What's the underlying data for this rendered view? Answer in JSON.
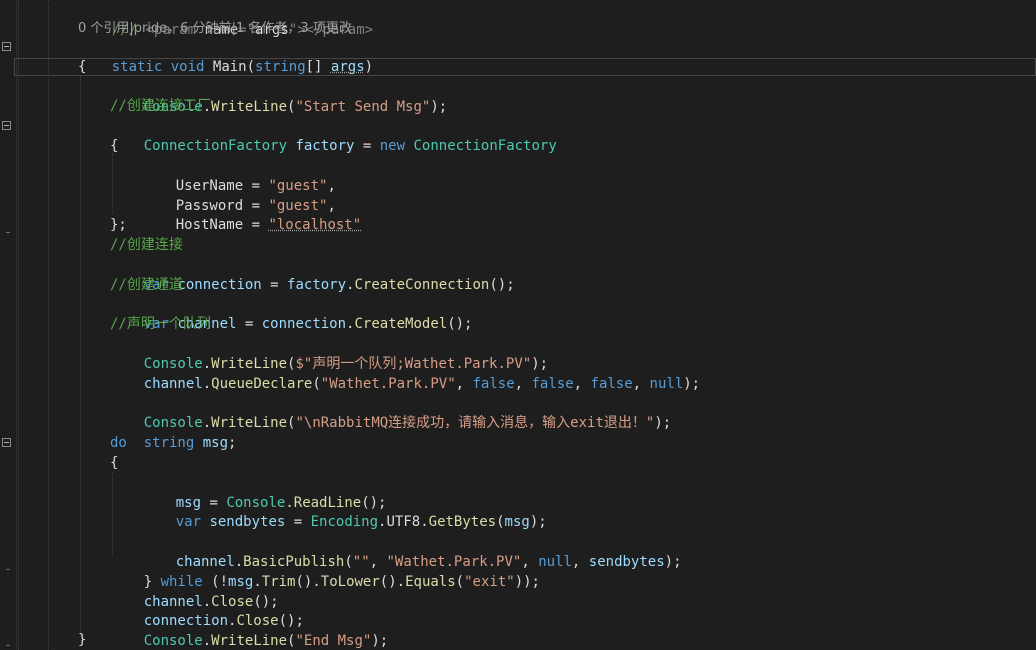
{
  "code": {
    "line1": {
      "doc": "/// ",
      "tag_open": "<param ",
      "attr": "name",
      "eq": "=\"",
      "value": "args",
      "quote": "\"",
      "tag_close": "></param>"
    },
    "codelens": "0 个引用|pride，6 分钟前|1 名作者，3 项更改",
    "line2": {
      "kw1": "static",
      "kw2": "void",
      "name": "Main",
      "paren": "(",
      "kw3": "string",
      "brackets": "[] ",
      "param": "args",
      "close": ")"
    },
    "line3": {
      "brace": "{"
    },
    "line4": {
      "cls": "Console",
      "dot": ".",
      "fn": "WriteLine",
      "open": "(",
      "str": "\"Start Send Msg\"",
      "close": ");"
    },
    "line5": {
      "comment": "//创建连接工厂"
    },
    "line6": {
      "type": "ConnectionFactory",
      "var": " factory",
      "eq": " = ",
      "kw": "new",
      "type2": " ConnectionFactory"
    },
    "line7": {
      "brace": "{"
    },
    "line8": {
      "prop": "UserName",
      "eq": " = ",
      "str": "\"guest\"",
      "end": ","
    },
    "line9": {
      "prop": "Password",
      "eq": " = ",
      "str": "\"guest\"",
      "end": ","
    },
    "line10": {
      "prop": "HostName",
      "eq": " = ",
      "str": "\"localhost\""
    },
    "line11": {
      "brace": "};"
    },
    "line12": {
      "comment": "//创建连接"
    },
    "line13": {
      "kw": "var",
      "var": " connection",
      "eq": " = ",
      "obj": "factory",
      "dot": ".",
      "fn": "CreateConnection",
      "end": "();"
    },
    "line14": {
      "comment": "//创建通道"
    },
    "line15": {
      "kw": "var",
      "var": " channel",
      "eq": " = ",
      "obj": "connection",
      "dot": ".",
      "fn": "CreateModel",
      "end": "();"
    },
    "line16": {
      "comment": "//声明一个队列"
    },
    "line17": {
      "cls": "Console",
      "dot": ".",
      "fn": "WriteLine",
      "open": "(",
      "str": "$\"声明一个队列;Wathet.Park.PV\"",
      "close": ");"
    },
    "line18": {
      "obj": "channel",
      "dot": ".",
      "fn": "QueueDeclare",
      "open": "(",
      "str": "\"Wathet.Park.PV\"",
      "c1": ", ",
      "f1": "false",
      "c2": ", ",
      "f2": "false",
      "c3": ", ",
      "f3": "false",
      "c4": ", ",
      "n": "null",
      "close": ");"
    },
    "line20": {
      "cls": "Console",
      "dot": ".",
      "fn": "WriteLine",
      "open": "(",
      "str": "\"\\nRabbitMQ连接成功，请输入消息，输入exit退出！\"",
      "close": ");"
    },
    "line21": {
      "kw": "string",
      "var": " msg",
      "end": ";"
    },
    "line22": {
      "kw": "do"
    },
    "line23": {
      "brace": "{"
    },
    "line24": {
      "var": "msg",
      "eq": " = ",
      "cls": "Console",
      "dot": ".",
      "fn": "ReadLine",
      "end": "();"
    },
    "line25": {
      "kw": "var",
      "var": " sendbytes",
      "eq": " = ",
      "cls": "Encoding",
      "dot": ".",
      "prop": "UTF8",
      "dot2": ".",
      "fn": "GetBytes",
      "open": "(",
      "arg": "msg",
      "close": ");"
    },
    "line27": {
      "obj": "channel",
      "dot": ".",
      "fn": "BasicPublish",
      "open": "(",
      "s1": "\"\"",
      "c1": ", ",
      "s2": "\"Wathet.Park.PV\"",
      "c2": ", ",
      "n": "null",
      "c3": ", ",
      "arg": "sendbytes",
      "close": ");"
    },
    "line28": {
      "brace": "} ",
      "kw": "while",
      "open": " (!",
      "var": "msg",
      "dot": ".",
      "fn1": "Trim",
      "p1": "().",
      "fn2": "ToLower",
      "p2": "().",
      "fn3": "Equals",
      "open2": "(",
      "str": "\"exit\"",
      "close": "));"
    },
    "line29": {
      "obj": "channel",
      "dot": ".",
      "fn": "Close",
      "end": "();"
    },
    "line30": {
      "obj": "connection",
      "dot": ".",
      "fn": "Close",
      "end": "();"
    },
    "line31": {
      "cls": "Console",
      "dot": ".",
      "fn": "WriteLine",
      "open": "(",
      "str": "\"End Msg\"",
      "close": ");"
    },
    "line32": {
      "brace": "}"
    }
  }
}
